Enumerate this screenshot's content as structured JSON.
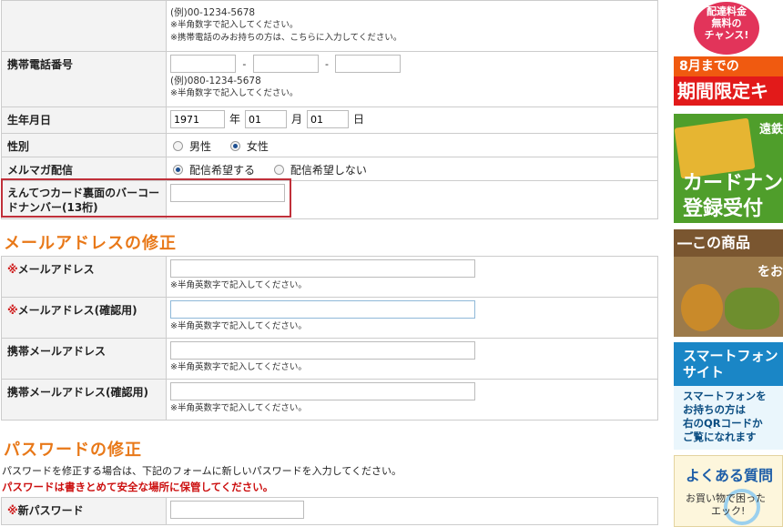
{
  "form": {
    "top_example": "(例)00-1234-5678",
    "top_note1": "※半角数字で記入してください。",
    "top_note2": "※携帯電話のみお持ちの方は、こちらに入力してください。",
    "mobile_label": "携帯電話番号",
    "mobile_sep": "-",
    "mobile_example": "(例)080-1234-5678",
    "mobile_note": "※半角数字で記入してください。",
    "birth_label": "生年月日",
    "birth_year": "1971",
    "birth_year_unit": "年",
    "birth_month": "01",
    "birth_month_unit": "月",
    "birth_day": "01",
    "birth_day_unit": "日",
    "gender_label": "性別",
    "gender_male": "男性",
    "gender_female": "女性",
    "magazine_label": "メルマガ配信",
    "magazine_yes": "配信希望する",
    "magazine_no": "配信希望しない",
    "card_label": "えんてつカード裏面のバーコードナンバー(13桁)",
    "card_value": ""
  },
  "email_section": {
    "heading": "メールアドレスの修正",
    "required_mark": "※",
    "email_label": "メールアドレス",
    "email_confirm_label": "メールアドレス(確認用)",
    "mobile_email_label": "携帯メールアドレス",
    "mobile_email_confirm_label": "携帯メールアドレス(確認用)",
    "note": "※半角英数字で記入してください。"
  },
  "password_section": {
    "heading": "パスワードの修正",
    "description": "パスワードを修正する場合は、下記のフォームに新しいパスワードを入力してください。",
    "warning": "パスワードは書きとめて安全な場所に保管してください。",
    "required_mark": "※",
    "new_password_label": "新パスワード"
  },
  "sidebar": {
    "b1_circle_l1": "配達料金",
    "b1_circle_l2": "無料の",
    "b1_circle_l3": "チャンス!",
    "b1_strip1": "8月までの",
    "b1_strip2": "期間限定キ",
    "b2_corner": "遠鉄",
    "b2_line1": "カードナン",
    "b2_line2": "登録受付",
    "b3_head": "―この商品",
    "b3_sub": "をお",
    "b4_head1": "スマートフォン",
    "b4_head2": "サイト",
    "b4_body1": "スマートフォンを",
    "b4_body2": "お持ちの方は",
    "b4_body3": "右のQRコードか",
    "b4_body4": "ご覧になれます",
    "b5_head": "よくある質問",
    "b5_body1": "お買い物で困った",
    "b5_body2": "エック!"
  }
}
